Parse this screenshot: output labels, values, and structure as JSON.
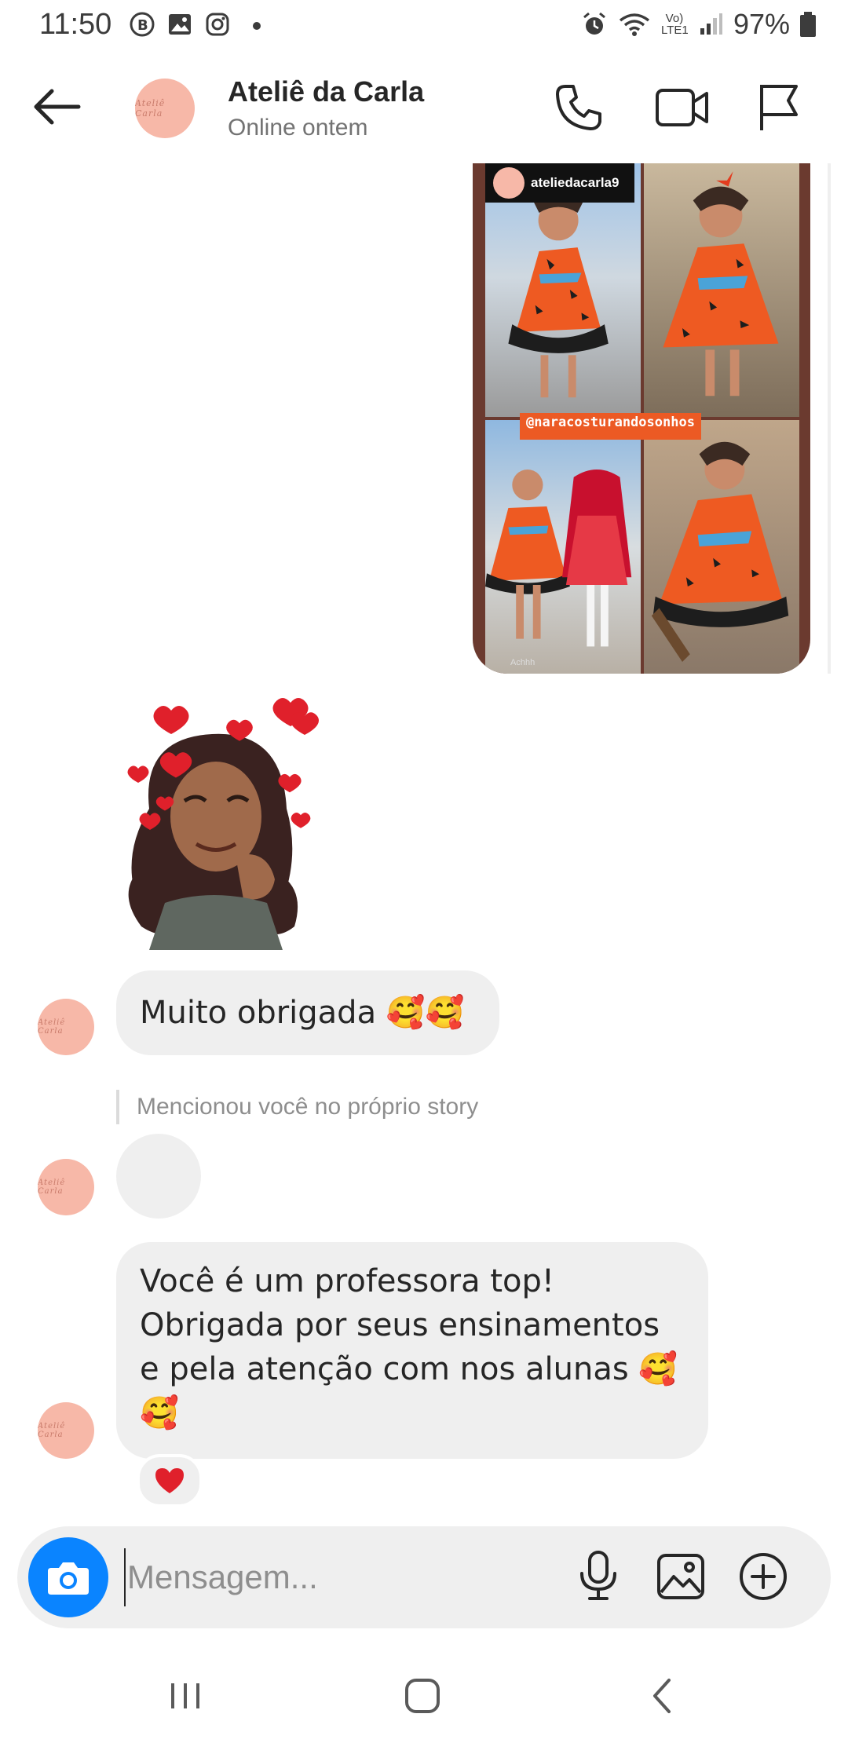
{
  "status_bar": {
    "time": "11:50",
    "battery": "97%",
    "left_icons": [
      "b-badge-icon",
      "gallery-icon",
      "instagram-icon",
      "dot-icon"
    ],
    "right_icons": [
      "alarm-icon",
      "wifi-icon",
      "volte-icon",
      "signal-icon",
      "battery-icon"
    ],
    "network_label": "Vo) LTE1"
  },
  "header": {
    "contact_name": "Ateliê da Carla",
    "contact_status": "Online ontem",
    "avatar_text": "Ateliê Carla"
  },
  "story": {
    "username": "ateliedacarla9",
    "mention_tag": "@naracosturandosonhos",
    "signature": "Achhh"
  },
  "messages": [
    {
      "id": "m1",
      "text": "Muito obrigada 🥰🥰"
    },
    {
      "id": "m2",
      "note": "Mencionou você no próprio story"
    },
    {
      "id": "m3",
      "text_lines": [
        "Você é um professora top!",
        "Obrigada por seus ensinamentos",
        "e pela atenção com nos alunas 🥰",
        "🥰"
      ],
      "reaction": "❤️"
    }
  ],
  "composer": {
    "placeholder": "Mensagem..."
  },
  "colors": {
    "accent": "#0a84ff",
    "bubble": "#efefef",
    "avatar": "#f7b8a8",
    "heart": "#e0245e",
    "mention_bg": "#ec5a24"
  }
}
